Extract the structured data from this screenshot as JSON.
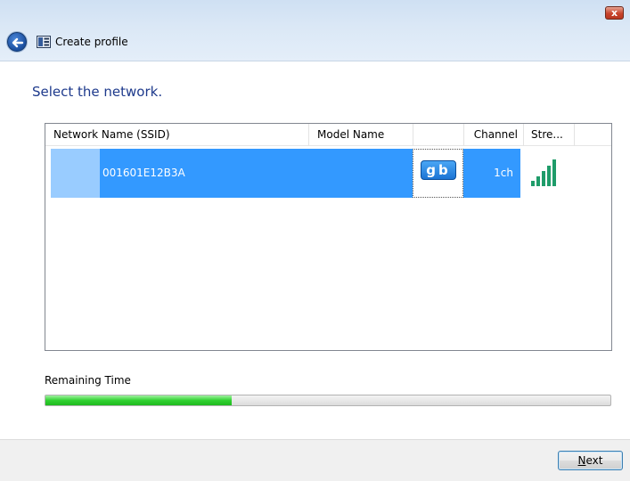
{
  "window": {
    "title": "Create profile",
    "close_label": "x",
    "back_icon": "back-arrow-icon",
    "title_icon": "profile-icon"
  },
  "page": {
    "heading": "Select the network."
  },
  "network_list": {
    "columns": [
      "Network Name (SSID)",
      "Model Name",
      "",
      "Channel",
      "Stre..."
    ],
    "rows": [
      {
        "ssid": "001601E12B3A",
        "model_name": "",
        "mode_badge": "gb",
        "channel": "1ch",
        "signal_strength_bars": 5,
        "selected": true
      }
    ]
  },
  "progress": {
    "label": "Remaining Time",
    "value_fraction": 0.33
  },
  "footer": {
    "next_label_accel": "N",
    "next_label_rest": "ext"
  },
  "colors": {
    "selection": "#3399ff",
    "selection_light": "#99ccff",
    "heading": "#1e3a8c",
    "progress": "#31d131"
  }
}
